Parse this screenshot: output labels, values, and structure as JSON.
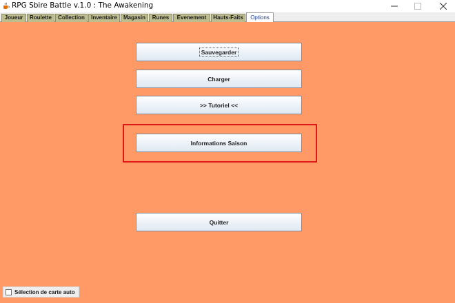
{
  "window": {
    "title": "RPG Sbire Battle v.1.0 : The Awakening",
    "app_icon": "java-cup-icon",
    "controls": [
      "minimize-icon",
      "maximize-icon",
      "close-icon"
    ]
  },
  "tabs": [
    {
      "label": "Joueur",
      "active": false
    },
    {
      "label": "Roulette",
      "active": false
    },
    {
      "label": "Collection",
      "active": false
    },
    {
      "label": "Inventaire",
      "active": false
    },
    {
      "label": "Magasin",
      "active": false
    },
    {
      "label": "Runes",
      "active": false
    },
    {
      "label": "Evenement",
      "active": false
    },
    {
      "label": "Hauts-Faits",
      "active": false
    },
    {
      "label": "Options",
      "active": true
    }
  ],
  "options": {
    "save_label": "Sauvegarder",
    "load_label": "Charger",
    "tutorial_label": ">> Tutoriel <<",
    "season_info_label": "Informations Saison",
    "quit_label": "Quitter",
    "auto_card_label": "Sélection de carte auto",
    "auto_card_checked": false
  },
  "colors": {
    "panel_background": "#ff9966",
    "highlight_border": "#e01818",
    "tab_background": "#bdbd8f",
    "active_tab_text": "#1f3f8a"
  }
}
